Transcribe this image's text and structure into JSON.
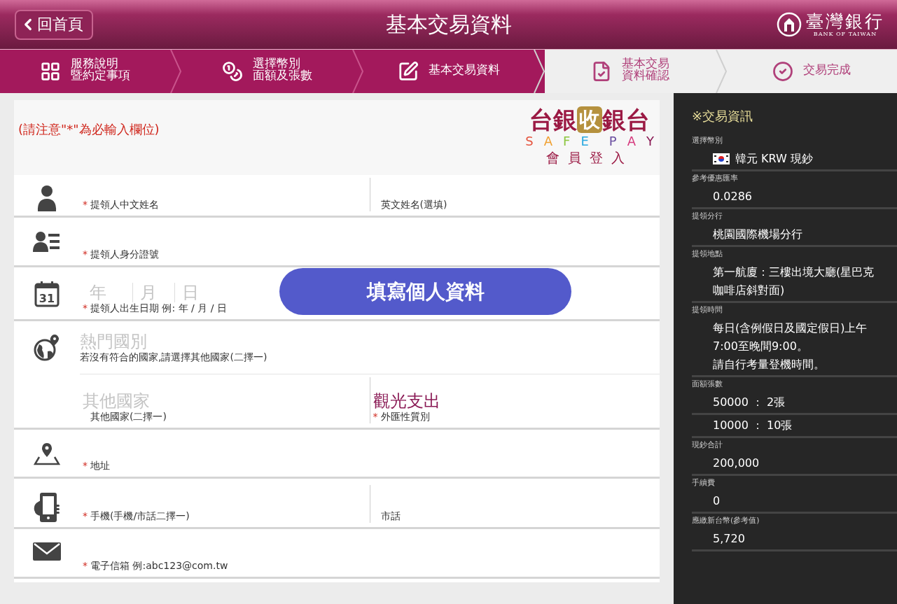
{
  "header": {
    "back_button": "回首頁",
    "title": "基本交易資料",
    "bank_name": "臺灣銀行",
    "bank_name_en": "BANK OF TAIWAN"
  },
  "steps": [
    {
      "lines": [
        "服務說明",
        "暨約定事項"
      ],
      "reached": true
    },
    {
      "lines": [
        "選擇幣別",
        "面額及張數"
      ],
      "reached": true
    },
    {
      "lines": [
        "基本交易資料"
      ],
      "reached": true
    },
    {
      "lines": [
        "基本交易",
        "資料確認"
      ],
      "reached": false
    },
    {
      "lines": [
        "交易完成"
      ],
      "reached": false
    }
  ],
  "form": {
    "notice": "(請注意\"*\"為必輸入欄位)",
    "required_mark": "*",
    "logo": {
      "left": "台銀",
      "center": "收",
      "right": "銀台",
      "tagline": [
        "S",
        "A",
        "F",
        "E",
        "P",
        "A",
        "Y"
      ],
      "caption": "會員登入"
    },
    "rows": [
      {
        "kind": "plain",
        "fields": [
          {
            "label": "提領人中文姓名",
            "required": true
          },
          {
            "label": "英文姓名(選填)",
            "required": false
          }
        ]
      },
      {
        "kind": "plain",
        "fields": [
          {
            "label": "提領人身分證號",
            "required": true
          }
        ]
      },
      {
        "icon_text": "31",
        "kind": "date",
        "placeholders": [
          "年",
          "月",
          "日"
        ],
        "label": "提領人出生日期 例: 年 / 月 / 日",
        "required": true
      },
      {
        "kind": "country",
        "top": {
          "placeholder": "熱門國別",
          "note": "若沒有符合的國家,請選擇其他國家(二擇一)"
        },
        "fields": [
          {
            "placeholder": "其他國家",
            "label": "其他國家(二擇一)",
            "required": false
          },
          {
            "value": "觀光支出",
            "label": "外匯性質別",
            "required": true
          }
        ]
      },
      {
        "kind": "plain",
        "fields": [
          {
            "label": "地址",
            "required": true
          }
        ]
      },
      {
        "kind": "plain",
        "fields": [
          {
            "label": "手機(手機/市話二擇一)",
            "required": true
          },
          {
            "label": "市話",
            "required": false
          }
        ]
      },
      {
        "kind": "plain",
        "fields": [
          {
            "label": "電子信箱 例:abc123@com.tw",
            "required": true
          }
        ]
      }
    ],
    "fill_button": "填寫個人資料"
  },
  "sidebar": {
    "title": "※交易資訊",
    "sections": [
      {
        "label": "選擇幣別",
        "values": [
          [
            "韓元 KRW 現鈔"
          ]
        ],
        "flag": true
      },
      {
        "label": "參考優惠匯率",
        "values": [
          [
            "0.0286"
          ]
        ]
      },
      {
        "label": "提領分行",
        "values": [
          [
            "桃園國際機場分行"
          ]
        ]
      },
      {
        "label": "提領地點",
        "values": [
          [
            "第一航廈：三樓出境大廳(星巴克咖啡店斜對面)"
          ]
        ]
      },
      {
        "label": "提領時間",
        "values": [
          [
            "每日(含例假日及國定假日)上午7:00至晚間9:00。",
            "請自行考量登機時間。"
          ]
        ]
      },
      {
        "label": "面額張數",
        "values": [
          [
            "50000 ： 2張"
          ],
          [
            "10000 ： 10張"
          ]
        ]
      },
      {
        "label": "現鈔合計",
        "values": [
          [
            "200,000"
          ]
        ]
      },
      {
        "label": "手續費",
        "values": [
          [
            "0"
          ]
        ]
      },
      {
        "label": "應繳新台幣(參考值)",
        "values": [
          [
            "5,720"
          ]
        ]
      }
    ]
  }
}
